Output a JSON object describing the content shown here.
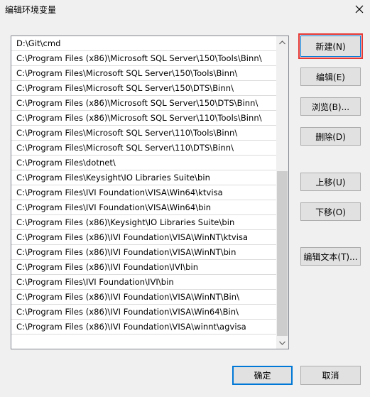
{
  "window": {
    "title": "编辑环境变量",
    "close_icon": "close-icon"
  },
  "paths": [
    "D:\\Git\\cmd",
    "C:\\Program Files (x86)\\Microsoft SQL Server\\150\\Tools\\Binn\\",
    "C:\\Program Files\\Microsoft SQL Server\\150\\Tools\\Binn\\",
    "C:\\Program Files\\Microsoft SQL Server\\150\\DTS\\Binn\\",
    "C:\\Program Files (x86)\\Microsoft SQL Server\\150\\DTS\\Binn\\",
    "C:\\Program Files (x86)\\Microsoft SQL Server\\110\\Tools\\Binn\\",
    "C:\\Program Files\\Microsoft SQL Server\\110\\Tools\\Binn\\",
    "C:\\Program Files\\Microsoft SQL Server\\110\\DTS\\Binn\\",
    "C:\\Program Files\\dotnet\\",
    "C:\\Program Files\\Keysight\\IO Libraries Suite\\bin",
    "C:\\Program Files\\IVI Foundation\\VISA\\Win64\\ktvisa",
    "C:\\Program Files\\IVI Foundation\\VISA\\Win64\\bin",
    "C:\\Program Files (x86)\\Keysight\\IO Libraries Suite\\bin",
    "C:\\Program Files (x86)\\IVI Foundation\\VISA\\WinNT\\ktvisa",
    "C:\\Program Files (x86)\\IVI Foundation\\VISA\\WinNT\\bin",
    "C:\\Program Files (x86)\\IVI Foundation\\IVI\\bin",
    "C:\\Program Files\\IVI Foundation\\IVI\\bin",
    "C:\\Program Files (x86)\\IVI Foundation\\VISA\\WinNT\\Bin\\",
    "C:\\Program Files (x86)\\IVI Foundation\\VISA\\Win64\\Bin\\",
    "C:\\Program Files (x86)\\IVI Foundation\\VISA\\winnt\\agvisa"
  ],
  "buttons": {
    "new": "新建(N)",
    "edit": "编辑(E)",
    "browse": "浏览(B)...",
    "delete": "删除(D)",
    "move_up": "上移(U)",
    "move_down": "下移(O)",
    "edit_text": "编辑文本(T)...",
    "ok": "确定",
    "cancel": "取消"
  },
  "colors": {
    "highlight": "#e53935",
    "focus": "#0078d7"
  }
}
